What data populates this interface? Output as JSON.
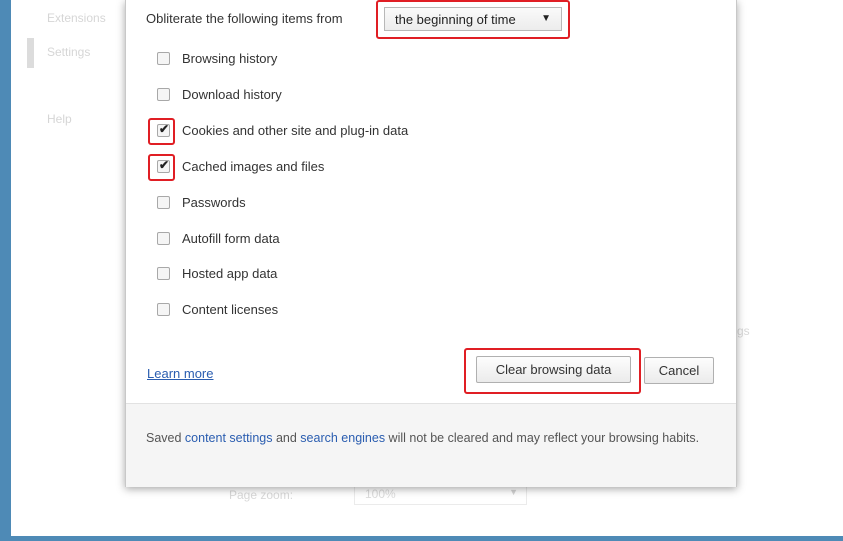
{
  "background": {
    "nav": [
      "Extensions",
      "Settings",
      "Help"
    ],
    "page_zoom_label": "Page zoom:",
    "page_zoom_value": "100%",
    "stray_text_right": "gs"
  },
  "dialog": {
    "obliterate_label": "Obliterate the following items from",
    "time_range": "the beginning of time",
    "items": [
      {
        "label": "Browsing history",
        "checked": false
      },
      {
        "label": "Download history",
        "checked": false
      },
      {
        "label": "Cookies and other site and plug-in data",
        "checked": true
      },
      {
        "label": "Cached images and files",
        "checked": true
      },
      {
        "label": "Passwords",
        "checked": false
      },
      {
        "label": "Autofill form data",
        "checked": false
      },
      {
        "label": "Hosted app data",
        "checked": false
      },
      {
        "label": "Content licenses",
        "checked": false
      }
    ],
    "learn_more": "Learn more",
    "clear_button": "Clear browsing data",
    "cancel_button": "Cancel",
    "footer": {
      "prefix": "Saved ",
      "link1": "content settings",
      "middle": " and ",
      "link2": "search engines",
      "suffix": " will not be cleared and may reflect your browsing habits."
    }
  },
  "colors": {
    "highlight": "#e01e24",
    "frame": "#4e8ab6",
    "link": "#2a5db0"
  }
}
